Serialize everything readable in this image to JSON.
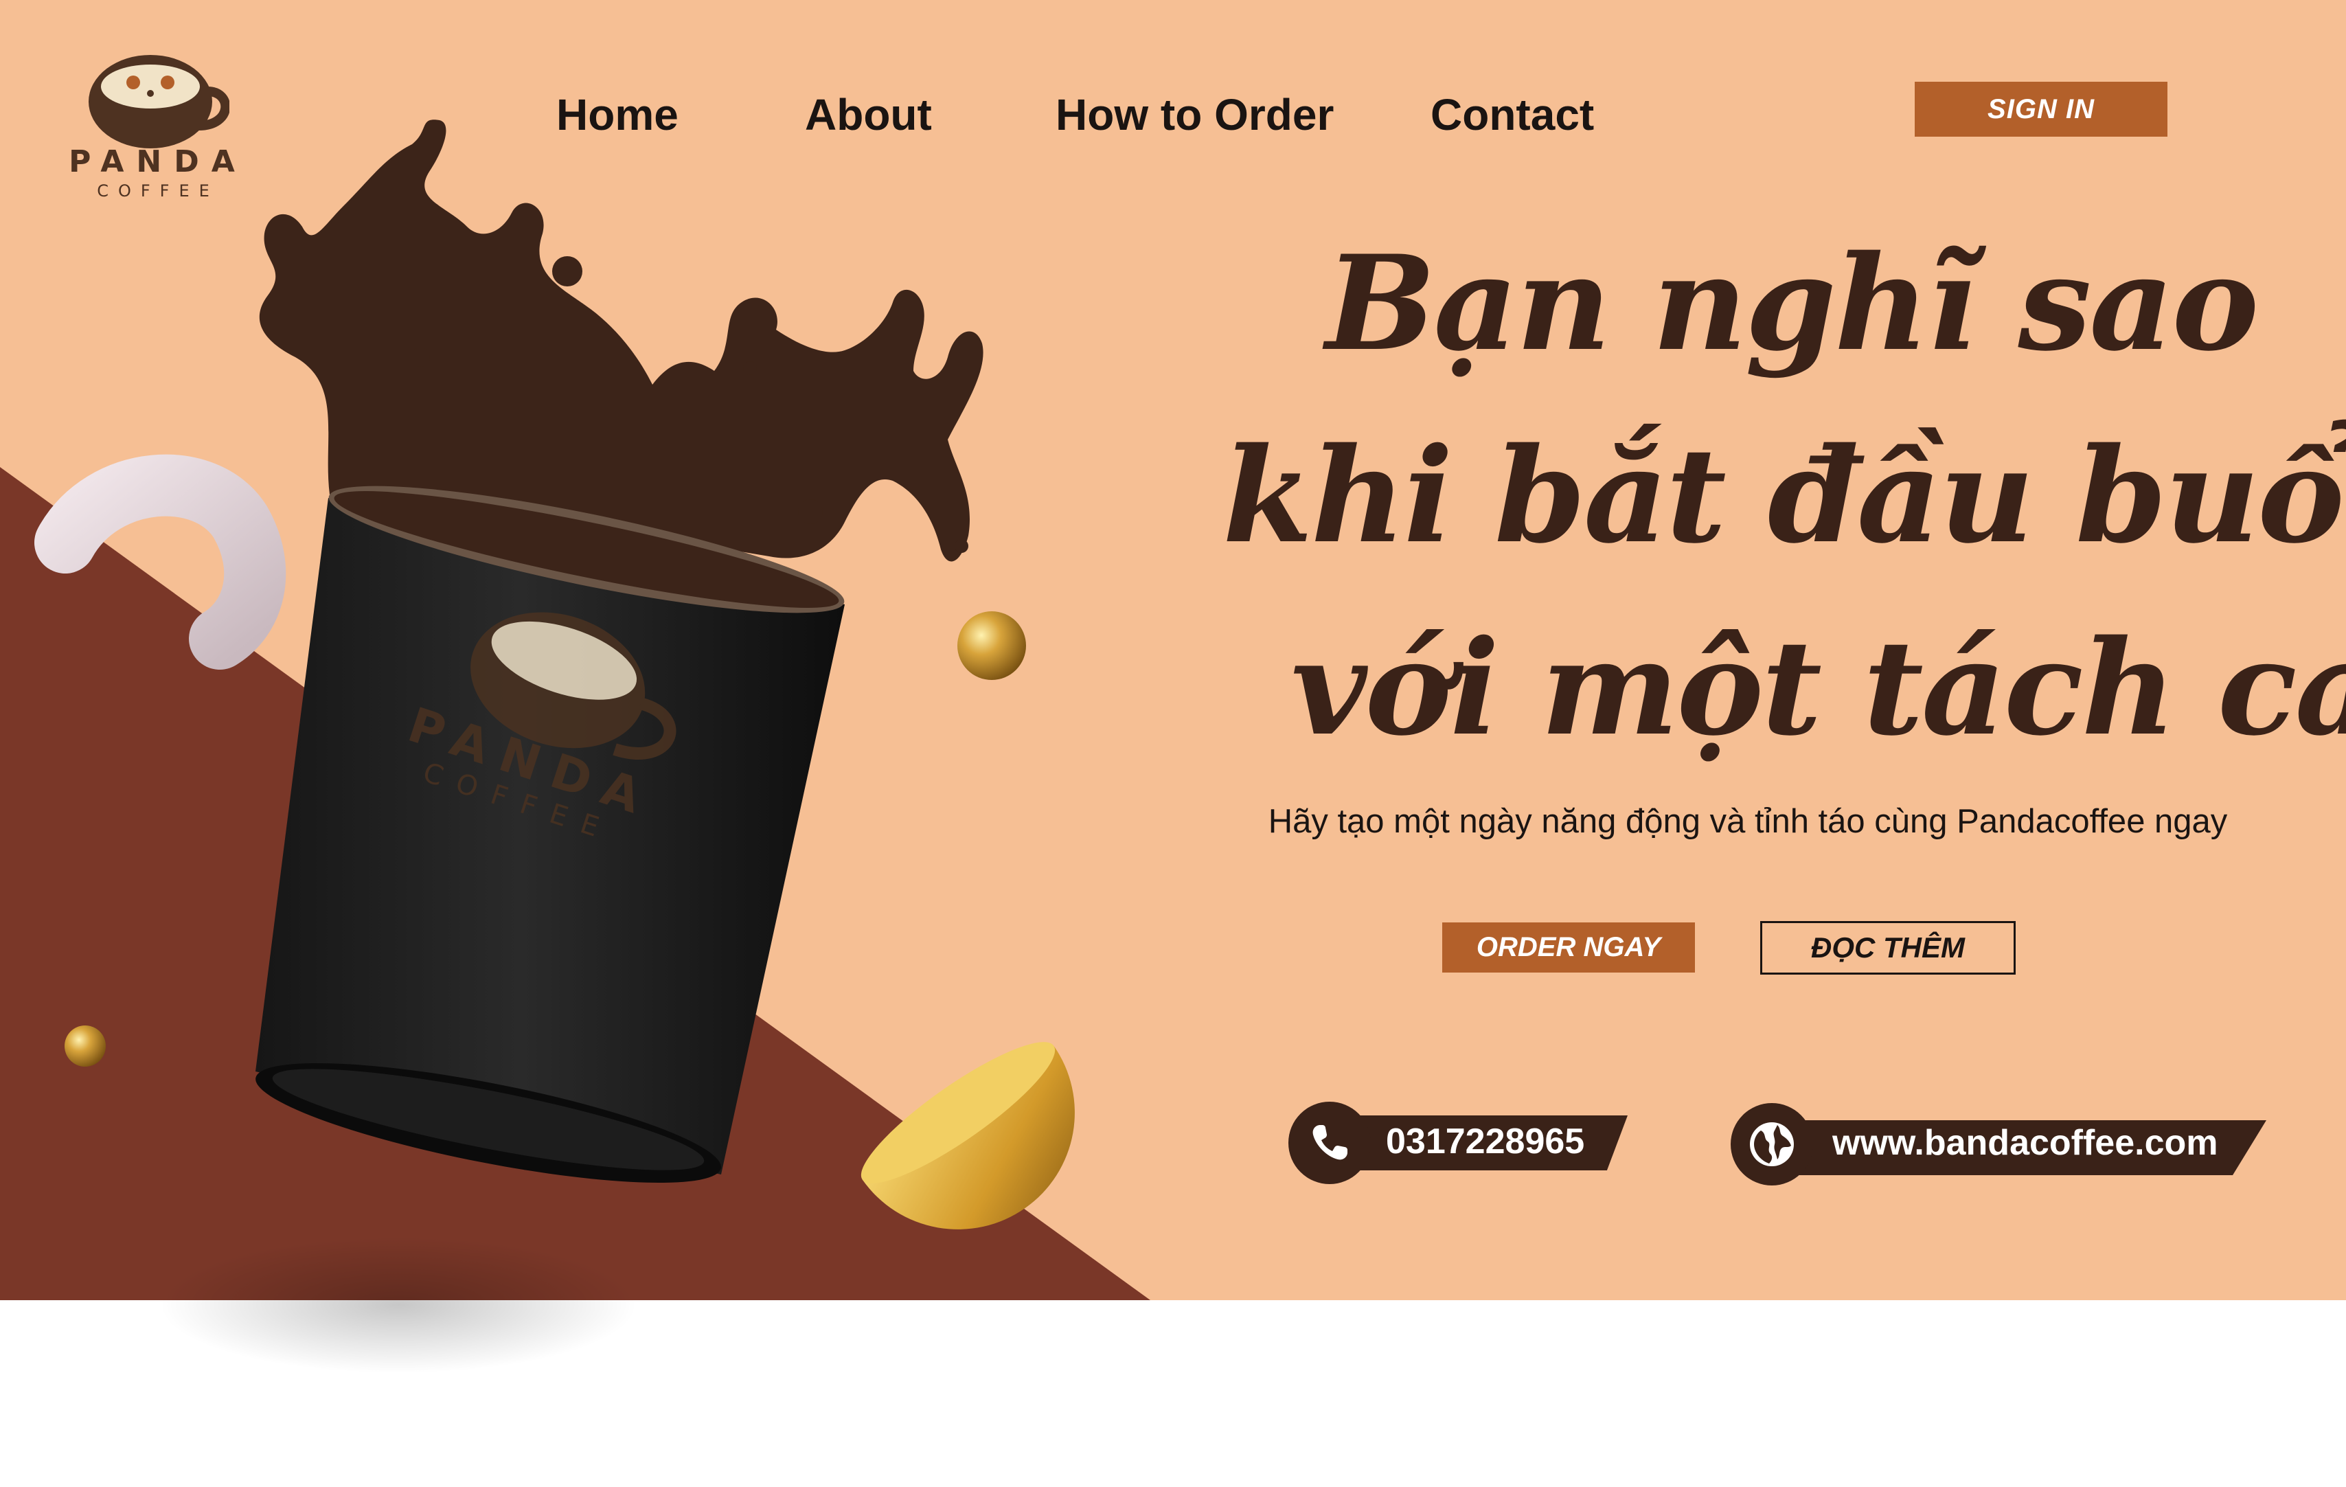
{
  "brand": {
    "name": "PANDA",
    "sub": "COFFEE"
  },
  "nav": {
    "items": [
      {
        "label": "Home"
      },
      {
        "label": "About"
      },
      {
        "label": "How to Order"
      },
      {
        "label": "Contact"
      }
    ],
    "signin_label": "SIGN IN"
  },
  "hero": {
    "headline_lines": [
      "Bạn nghĩ sao",
      "khi bắt đầu buổi sáng",
      "với một tách cafe"
    ],
    "tagline": "Hãy tạo một ngày năng động và tỉnh táo cùng Pandacoffee ngay",
    "order_label": "ORDER NGAY",
    "more_label": "ĐỌC THÊM"
  },
  "contact": {
    "phone": "0317228965",
    "website": "www.bandacoffee.com"
  },
  "colors": {
    "background": "#f6bf94",
    "accent": "#b3602a",
    "dark_brown": "#3a2218",
    "diagonal": "#7a3728",
    "cup": "#1f1f1f"
  },
  "icons": [
    "coffee-cup-logo-icon",
    "phone-icon",
    "globe-icon"
  ]
}
